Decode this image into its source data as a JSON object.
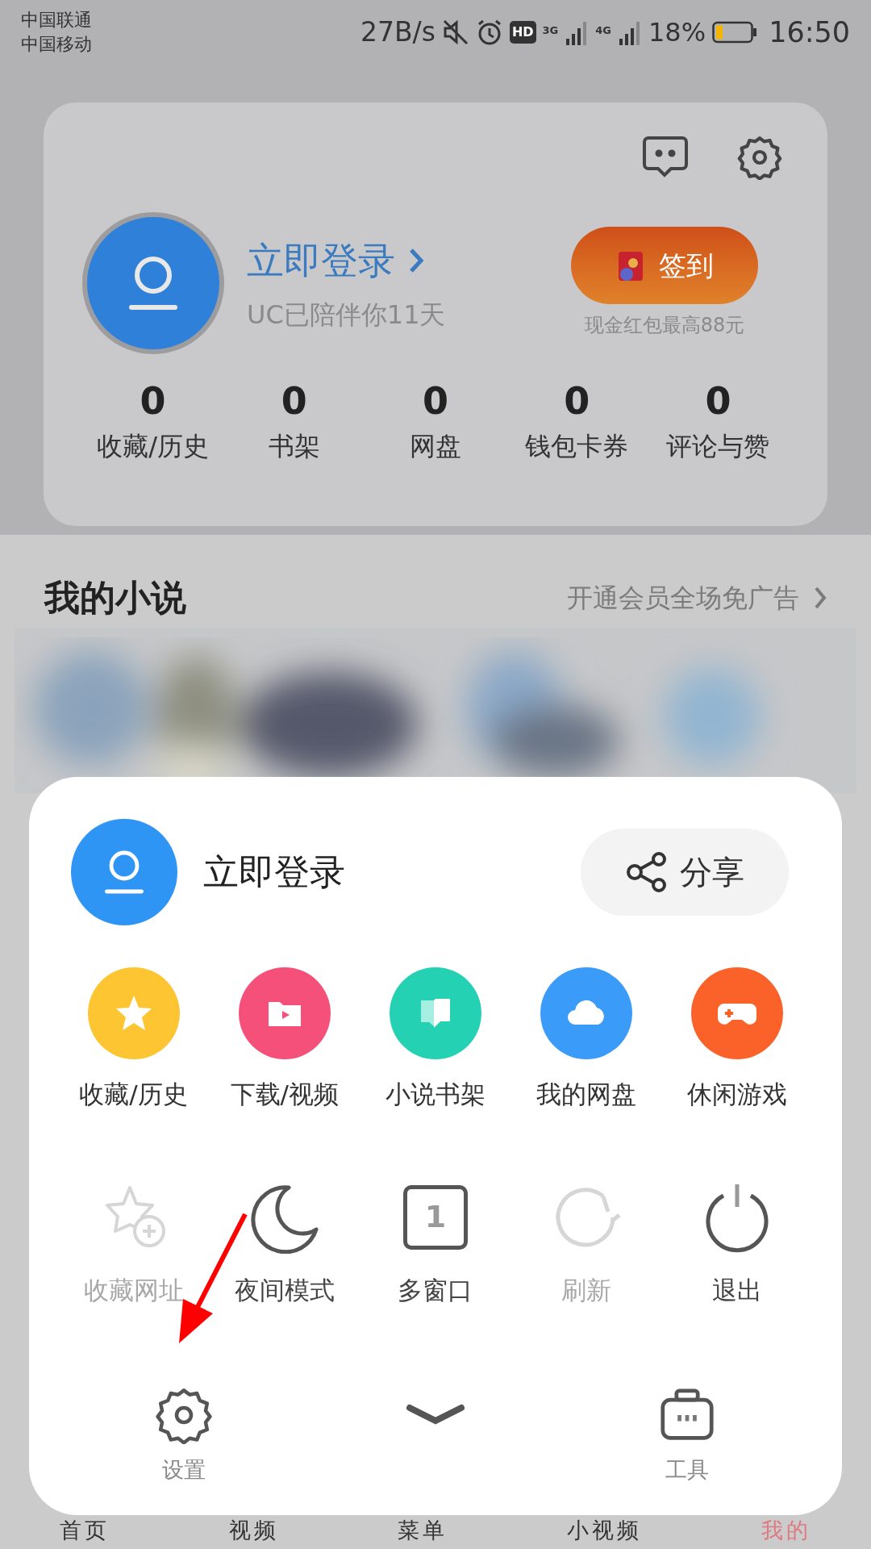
{
  "status_bar": {
    "carriers": [
      "中国联通",
      "中国移动"
    ],
    "speed": "27B/s",
    "hd": "HD",
    "network_1": "3G",
    "network_2": "4G",
    "battery": "18%",
    "time": "16:50"
  },
  "profile_card": {
    "login": "立即登录",
    "subtitle": "UC已陪伴你11天",
    "checkin": {
      "label": "签到",
      "note": "现金红包最高88元"
    },
    "stats": [
      {
        "value": "0",
        "label": "收藏/历史"
      },
      {
        "value": "0",
        "label": "书架"
      },
      {
        "value": "0",
        "label": "网盘"
      },
      {
        "value": "0",
        "label": "钱包卡券"
      },
      {
        "value": "0",
        "label": "评论与赞"
      }
    ]
  },
  "novels": {
    "title": "我的小说",
    "promo": "开通会员全场免广告",
    "kind": "picture"
  },
  "menu": {
    "login": "立即登录",
    "share": "分享",
    "apps": [
      {
        "label": "收藏/历史",
        "kind": "star",
        "color": "#fcc531"
      },
      {
        "label": "下载/视频",
        "kind": "folder",
        "color": "#f5507a"
      },
      {
        "label": "小说书架",
        "kind": "book",
        "color": "#24d1b3"
      },
      {
        "label": "我的网盘",
        "kind": "cloud",
        "color": "#3a9cf8"
      },
      {
        "label": "休闲游戏",
        "kind": "gamepad",
        "color": "#fb6229"
      }
    ],
    "actions": [
      {
        "label": "收藏网址",
        "kind": "star-add",
        "disabled": true
      },
      {
        "label": "夜间模式",
        "kind": "moon",
        "disabled": false
      },
      {
        "label": "多窗口",
        "kind": "windows",
        "count": "1",
        "disabled": false
      },
      {
        "label": "刷新",
        "kind": "refresh",
        "disabled": true
      },
      {
        "label": "退出",
        "kind": "power",
        "disabled": false
      }
    ],
    "bottom": [
      {
        "label": "设置",
        "kind": "gear"
      },
      {
        "kind": "collapse"
      },
      {
        "label": "工具",
        "kind": "toolbox"
      }
    ]
  },
  "nav": [
    {
      "label": "首页",
      "selected": false
    },
    {
      "label": "视频",
      "selected": false
    },
    {
      "label": "菜单",
      "selected": false
    },
    {
      "label": "小视频",
      "selected": false
    },
    {
      "label": "我的",
      "selected": true
    }
  ]
}
